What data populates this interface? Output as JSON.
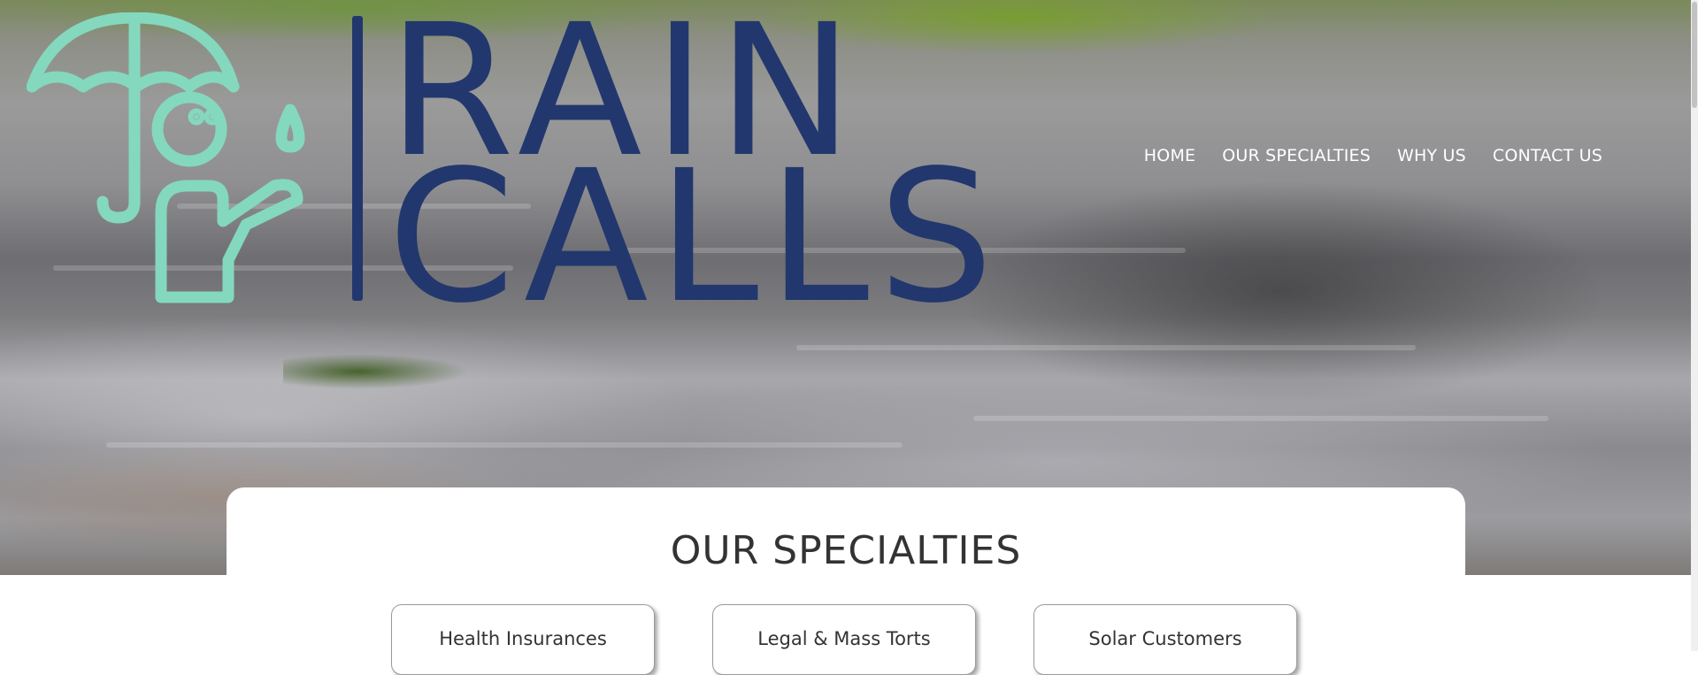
{
  "brand": {
    "line1": "RAIN",
    "line2": "CALLS",
    "mark_icon": "umbrella-person-icon",
    "colors": {
      "mark": "#84d8bd",
      "wordmark": "#22376d"
    }
  },
  "nav": {
    "items": [
      "HOME",
      "OUR SPECIALTIES",
      "WHY US",
      "CONTACT US"
    ]
  },
  "specialties": {
    "title": "OUR SPECIALTIES",
    "cards": [
      "Health Insurances",
      "Legal & Mass Torts",
      "Solar Customers"
    ]
  }
}
